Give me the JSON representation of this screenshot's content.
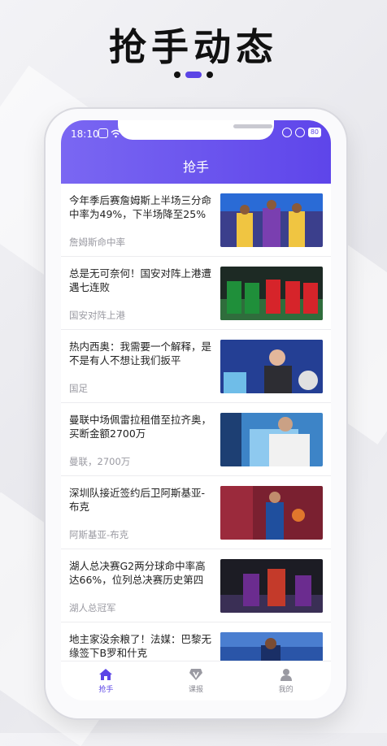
{
  "promo": {
    "title": "抢手动态"
  },
  "status_bar": {
    "time": "18:10",
    "battery": "80"
  },
  "header": {
    "title": "抢手"
  },
  "news": [
    {
      "title": "今年季后赛詹姆斯上半场三分命中率为49%，下半场降至25%",
      "tag": "詹姆斯命中率"
    },
    {
      "title": "总是无可奈何！国安对阵上港遭遇七连败",
      "tag": "国安对阵上港"
    },
    {
      "title": "热内西奥：我需要一个解释，是不是有人不想让我们扳平",
      "tag": "国足"
    },
    {
      "title": "曼联中场佩雷拉租借至拉齐奥，买断金额2700万",
      "tag": "曼联，2700万"
    },
    {
      "title": "深圳队接近签约后卫阿斯基亚-布克",
      "tag": "阿斯基亚-布克"
    },
    {
      "title": "湖人总决赛G2两分球命中率高达66%，位列总决赛历史第四",
      "tag": "湖人总冠军"
    },
    {
      "title": "地主家没余粮了！法媒：巴黎无缘签下B罗和什克",
      "tag": ""
    }
  ],
  "tabs": [
    {
      "label": "抢手",
      "icon": "home-icon",
      "active": true
    },
    {
      "label": "课报",
      "icon": "v-badge-icon",
      "active": false
    },
    {
      "label": "我的",
      "icon": "user-icon",
      "active": false
    }
  ],
  "colors": {
    "accent": "#5b44e6",
    "header_gradient_start": "#7a67f2",
    "header_gradient_end": "#5e45ea"
  }
}
